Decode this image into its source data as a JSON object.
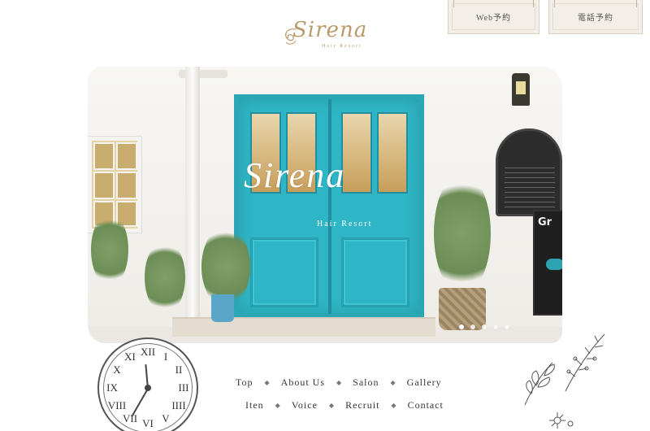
{
  "header": {
    "reserve_web": "Web予約",
    "reserve_tel": "電話予約",
    "logo_script": "Sirena",
    "logo_sub": "Hair Resort"
  },
  "hero": {
    "door_logo": "Sirena",
    "door_sub": "Hair Resort",
    "board_text": "Gr",
    "slides": 5,
    "active_slide": 1
  },
  "nav": {
    "row1": [
      "Top",
      "About Us",
      "Salon",
      "Gallery"
    ],
    "row2": [
      "Iten",
      "Voice",
      "Recruit",
      "Contact"
    ],
    "separator": "◆"
  },
  "clock": {
    "numerals": [
      "XII",
      "I",
      "II",
      "III",
      "IIII",
      "V",
      "VI",
      "VII",
      "VIII",
      "IX",
      "X",
      "XI"
    ]
  },
  "colors": {
    "accent_gold": "#b99a6b",
    "door_turquoise": "#2fb6c6",
    "button_bg": "#f3efe8"
  }
}
